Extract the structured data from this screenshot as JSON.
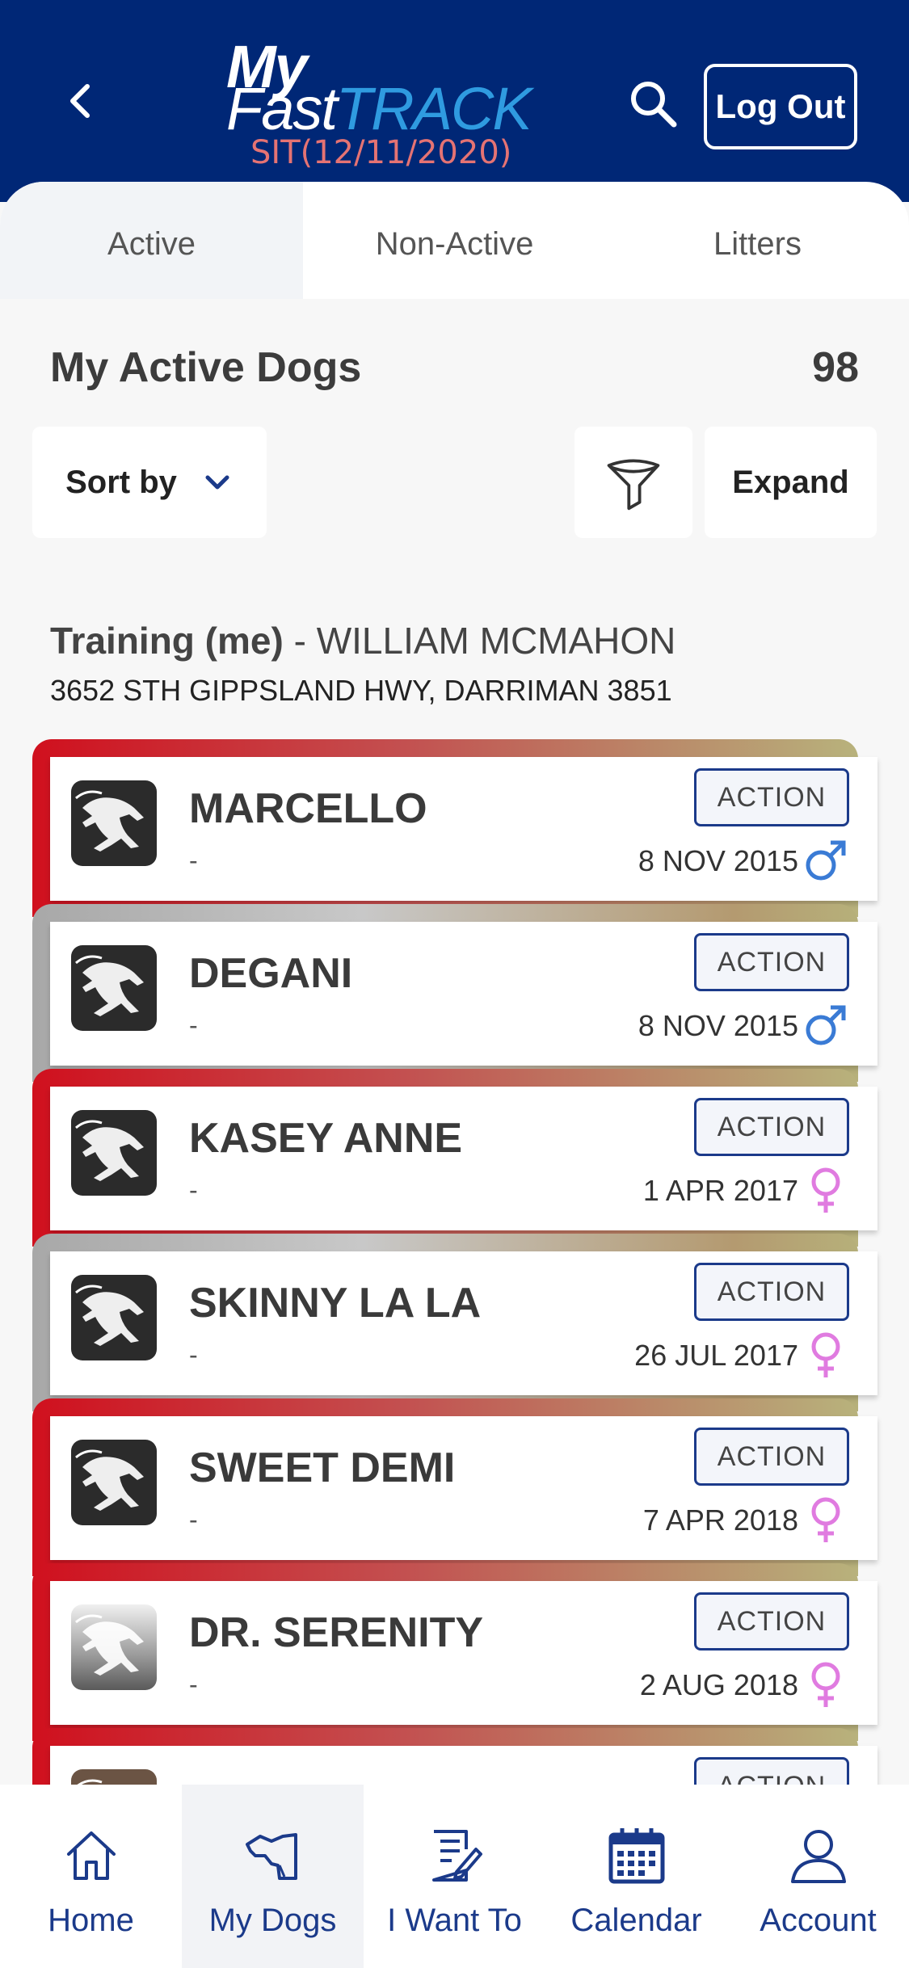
{
  "header": {
    "logo_my": "My",
    "logo_fast": "Fast",
    "logo_track": "TRACK",
    "logo_subtitle": "SIT(12/11/2020)",
    "logout_label": "Log Out",
    "back_icon": "chevron-left-icon",
    "search_icon": "search-icon",
    "bg_color": "#002776",
    "accent_color": "#2f9be0"
  },
  "tabs": [
    {
      "label": "Active",
      "selected": true
    },
    {
      "label": "Non-Active",
      "selected": false
    },
    {
      "label": "Litters",
      "selected": false
    }
  ],
  "section": {
    "title": "My Active Dogs",
    "count": "98"
  },
  "toolbar": {
    "sort_label": "Sort by",
    "filter_icon": "filter-icon",
    "expand_label": "Expand"
  },
  "group": {
    "role": "Training (me)",
    "separator": " - ",
    "owner": "WILLIAM MCMAHON",
    "address": "3652 STH GIPPSLAND HWY, DARRIMAN 3851"
  },
  "dogs": [
    {
      "name": "MARCELLO",
      "sub": "-",
      "date": "8 NOV 2015",
      "gender": "male",
      "action": "ACTION"
    },
    {
      "name": "DEGANI",
      "sub": "-",
      "date": "8 NOV 2015",
      "gender": "male",
      "action": "ACTION"
    },
    {
      "name": "KASEY ANNE",
      "sub": "-",
      "date": "1 APR 2017",
      "gender": "female",
      "action": "ACTION"
    },
    {
      "name": "SKINNY LA LA",
      "sub": "-",
      "date": "26 JUL 2017",
      "gender": "female",
      "action": "ACTION"
    },
    {
      "name": "SWEET DEMI",
      "sub": "-",
      "date": "7 APR 2018",
      "gender": "female",
      "action": "ACTION"
    },
    {
      "name": "DR. SERENITY",
      "sub": "-",
      "date": "2 AUG 2018",
      "gender": "female",
      "action": "ACTION"
    },
    {
      "name": "",
      "sub": "",
      "date": "",
      "gender": "",
      "action": "ACTION"
    }
  ],
  "colors": {
    "male": "#3a7bd5",
    "female": "#e07be0",
    "card_red": "#d0101e",
    "card_grey": "#a8a8a8",
    "nav": "#1b3a8a"
  },
  "bottom_nav": [
    {
      "label": "Home",
      "icon": "home-icon"
    },
    {
      "label": "My Dogs",
      "icon": "dog-icon"
    },
    {
      "label": "I Want To",
      "icon": "edit-document-icon"
    },
    {
      "label": "Calendar",
      "icon": "calendar-icon"
    },
    {
      "label": "Account",
      "icon": "user-icon"
    }
  ]
}
